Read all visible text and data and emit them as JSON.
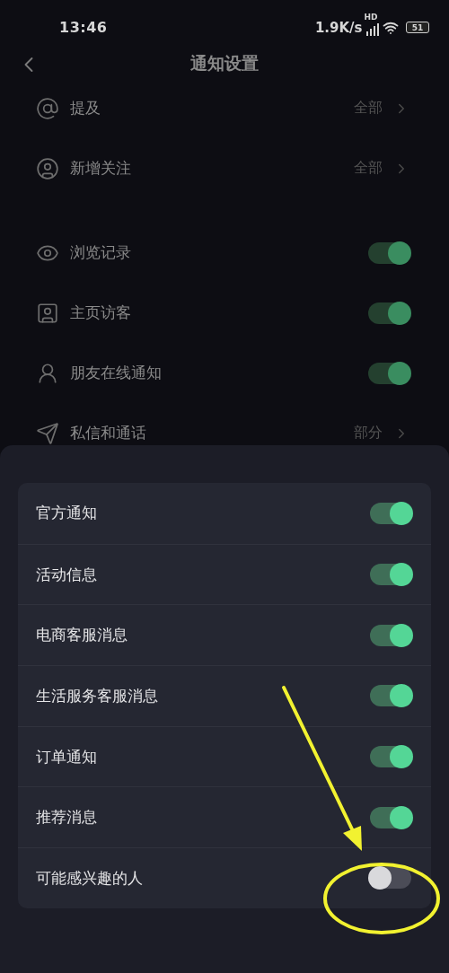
{
  "status_bar": {
    "time": "13:46",
    "speed": "1.9K/s",
    "network_tag": "HD",
    "battery": "51"
  },
  "window": {
    "title": "通知设置"
  },
  "settings": [
    {
      "kind": "value",
      "label": "提及",
      "value": "全部"
    },
    {
      "kind": "value",
      "label": "新增关注",
      "value": "全部"
    },
    {
      "kind": "toggle",
      "label": "浏览记录",
      "on": true
    },
    {
      "kind": "toggle",
      "label": "主页访客",
      "on": true
    },
    {
      "kind": "toggle",
      "label": "朋友在线通知",
      "on": true
    },
    {
      "kind": "value",
      "label": "私信和通话",
      "value": "部分"
    }
  ],
  "sheet": {
    "items": [
      {
        "label": "官方通知",
        "on": true
      },
      {
        "label": "活动信息",
        "on": true
      },
      {
        "label": "电商客服消息",
        "on": true
      },
      {
        "label": "生活服务客服消息",
        "on": true
      },
      {
        "label": "订单通知",
        "on": true
      },
      {
        "label": "推荐消息",
        "on": true
      },
      {
        "label": "可能感兴趣的人",
        "on": false
      }
    ]
  }
}
